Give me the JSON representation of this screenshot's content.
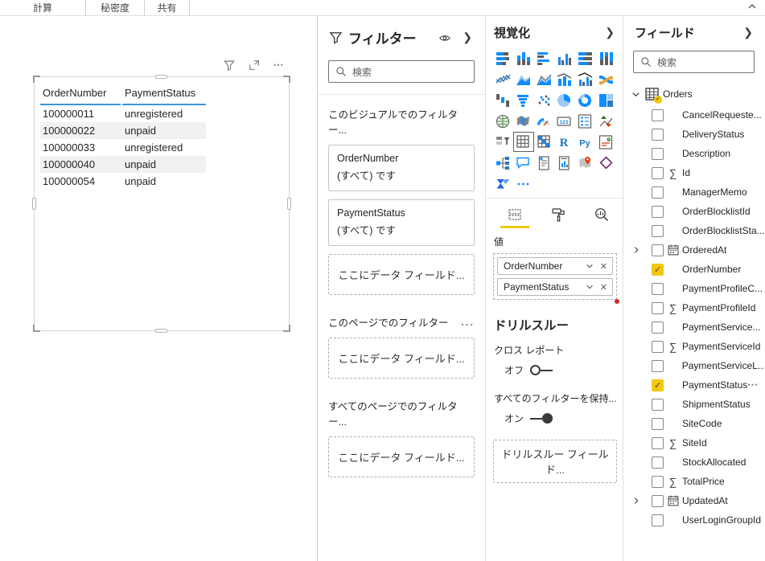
{
  "ribbon": {
    "tabs": [
      "計算",
      "秘密度",
      "共有"
    ],
    "collapse_icon": "chevron-up-icon"
  },
  "canvas": {
    "visual": {
      "header_icons": [
        "filter-icon",
        "focus-mode-icon",
        "more-options-icon"
      ],
      "table": {
        "columns": [
          "OrderNumber",
          "PaymentStatus"
        ],
        "rows": [
          [
            "100000011",
            "unregistered"
          ],
          [
            "100000022",
            "unpaid"
          ],
          [
            "100000033",
            "unregistered"
          ],
          [
            "100000040",
            "unpaid"
          ],
          [
            "100000054",
            "unpaid"
          ]
        ]
      }
    }
  },
  "filters_pane": {
    "title": "フィルター",
    "title_icon": "funnel-icon",
    "header_icons": [
      "eye-icon",
      "chevron-right-icon"
    ],
    "search_placeholder": "検索",
    "sections": [
      {
        "title": "このビジュアルでのフィルター...",
        "cards": [
          {
            "field": "OrderNumber",
            "condition": "(すべて) です"
          },
          {
            "field": "PaymentStatus",
            "condition": "(すべて) です"
          }
        ],
        "drop_placeholder": "ここにデータ フィールド..."
      },
      {
        "title": "このページでのフィルター",
        "more": "...",
        "drop_placeholder": "ここにデータ フィールド..."
      },
      {
        "title": "すべてのページでのフィルター...",
        "drop_placeholder": "ここにデータ フィールド..."
      }
    ]
  },
  "visualizations_pane": {
    "title": "視覚化",
    "collapse_icon": "chevron-right-icon",
    "selected_visual": "table",
    "visual_icons": [
      "stacked-bar-chart",
      "stacked-column-chart",
      "clustered-bar-chart",
      "clustered-column-chart",
      "100-stacked-bar-chart",
      "100-stacked-column-chart",
      "line-chart",
      "area-chart",
      "stacked-area-chart",
      "line-and-stacked-column-chart",
      "line-and-clustered-column-chart",
      "ribbon-chart",
      "waterfall-chart",
      "funnel",
      "scatter-chart",
      "pie-chart",
      "donut-chart",
      "treemap",
      "map",
      "filled-map",
      "gauge",
      "card",
      "multi-row-card",
      "kpi",
      "slicer",
      "table",
      "matrix",
      "r-script-visual",
      "python-visual",
      "key-influencers",
      "decomposition-tree",
      "q-and-a",
      "smart-narrative",
      "paginated-report",
      "arcgis-map",
      "power-apps",
      "power-automate",
      "get-more-visuals"
    ],
    "tabs": [
      "fields-tab",
      "format-tab",
      "analytics-tab"
    ],
    "active_tab": "fields-tab",
    "values_label": "値",
    "wells": [
      {
        "field": "OrderNumber"
      },
      {
        "field": "PaymentStatus"
      }
    ],
    "drillthrough": {
      "title": "ドリルスルー",
      "cross_report_label": "クロス レポート",
      "cross_report_state": "オフ",
      "keep_filters_label": "すべてのフィルターを保持...",
      "keep_filters_state": "オン",
      "drop_placeholder": "ドリルスルー フィールド..."
    }
  },
  "fields_pane": {
    "title": "フィールド",
    "collapse_icon": "chevron-right-icon",
    "search_placeholder": "検索",
    "table": {
      "name": "Orders",
      "expanded": true,
      "checked_badge": true
    },
    "fields": [
      {
        "name": "CancelRequeste...",
        "checked": false
      },
      {
        "name": "DeliveryStatus",
        "checked": false
      },
      {
        "name": "Description",
        "checked": false
      },
      {
        "name": "Id",
        "type": "sum",
        "checked": false
      },
      {
        "name": "ManagerMemo",
        "checked": false
      },
      {
        "name": "OrderBlocklistId",
        "checked": false
      },
      {
        "name": "OrderBlocklistSta...",
        "checked": false
      },
      {
        "name": "OrderedAt",
        "type": "date",
        "expandable": true,
        "checked": false
      },
      {
        "name": "OrderNumber",
        "checked": true
      },
      {
        "name": "PaymentProfileC...",
        "checked": false
      },
      {
        "name": "PaymentProfileId",
        "type": "sum",
        "checked": false
      },
      {
        "name": "PaymentService...",
        "checked": false
      },
      {
        "name": "PaymentServiceId",
        "type": "sum",
        "checked": false
      },
      {
        "name": "PaymentServiceL...",
        "checked": false
      },
      {
        "name": "PaymentStatus",
        "checked": true,
        "more": "⋯"
      },
      {
        "name": "ShipmentStatus",
        "checked": false
      },
      {
        "name": "SiteCode",
        "checked": false
      },
      {
        "name": "SiteId",
        "type": "sum",
        "checked": false
      },
      {
        "name": "StockAllocated",
        "checked": false
      },
      {
        "name": "TotalPrice",
        "type": "sum",
        "checked": false
      },
      {
        "name": "UpdatedAt",
        "type": "date",
        "expandable": true,
        "checked": false
      },
      {
        "name": "UserLoginGroupId",
        "checked": false
      }
    ]
  },
  "colors": {
    "accent_yellow": "#F2C811",
    "icon_blue": "#118DFF",
    "icon_gray": "#605E5C",
    "table_header_underline": "#3a96dd",
    "row_stripe": "#f2f1ef",
    "notification_red": "#cc2b2b"
  }
}
